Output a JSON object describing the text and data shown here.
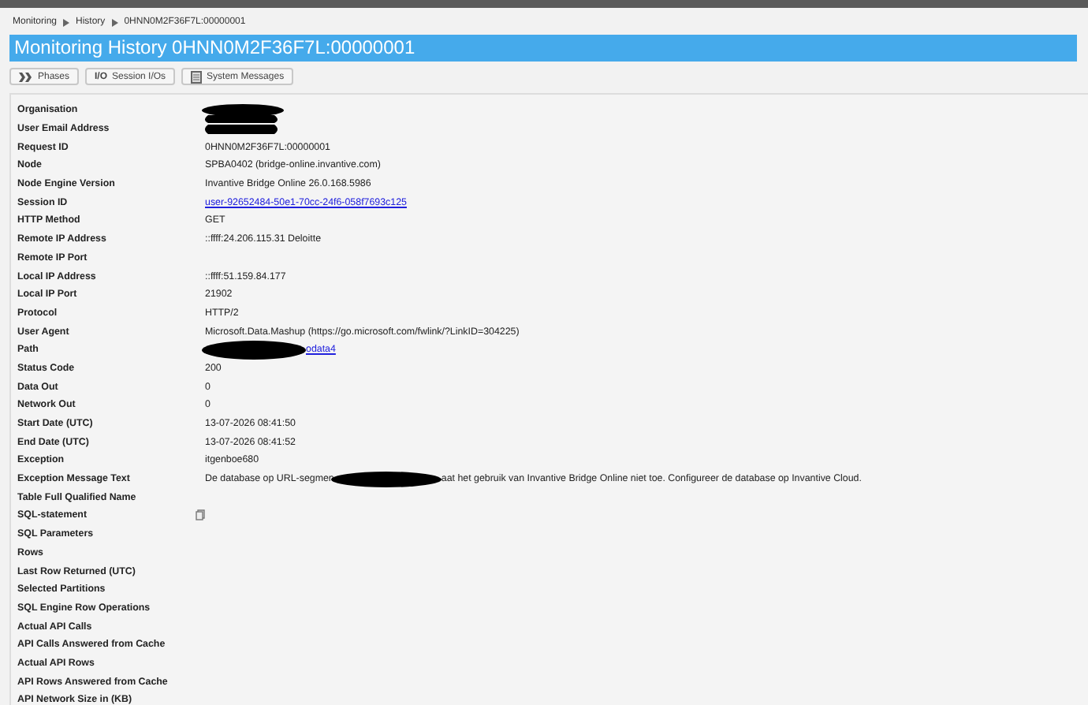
{
  "breadcrumb": [
    "Monitoring",
    "History",
    "0HNN0M2F36F7L:00000001"
  ],
  "title": "Monitoring History 0HNN0M2F36F7L:00000001",
  "buttons": [
    {
      "label": "Phases",
      "kind": "phases"
    },
    {
      "label": "Session I/Os",
      "kind": "io",
      "icon_text": "I/O"
    },
    {
      "label": "System Messages",
      "kind": "messages"
    }
  ],
  "rows": [
    {
      "label": "Organisation",
      "kind": "redacted"
    },
    {
      "label": "User Email Address",
      "kind": "redacted_double"
    },
    {
      "label": "Request ID",
      "kind": "text",
      "value": "0HNN0M2F36F7L:00000001"
    },
    {
      "label": "Node",
      "kind": "text",
      "value": "SPBA0402 (bridge-online.invantive.com)"
    },
    {
      "label": "Node Engine Version",
      "kind": "text",
      "value": "Invantive Bridge Online 26.0.168.5986"
    },
    {
      "label": "Session ID",
      "kind": "link",
      "value": "user-92652484-50e1-70cc-24f6-058f7693c125"
    },
    {
      "label": "HTTP Method",
      "kind": "text",
      "value": "GET"
    },
    {
      "label": "Remote IP Address",
      "kind": "text",
      "value": "::ffff:24.206.115.31 Deloitte"
    },
    {
      "label": "Remote IP Port",
      "kind": "empty"
    },
    {
      "label": "Local IP Address",
      "kind": "text",
      "value": "::ffff:51.159.84.177"
    },
    {
      "label": "Local IP Port",
      "kind": "text",
      "value": "21902"
    },
    {
      "label": "Protocol",
      "kind": "text",
      "value": "HTTP/2"
    },
    {
      "label": "User Agent",
      "kind": "text",
      "value": "Microsoft.Data.Mashup (https://go.microsoft.com/fwlink/?LinkID=304225)"
    },
    {
      "label": "Path",
      "kind": "redacted_link",
      "after": "odata4"
    },
    {
      "label": "Status Code",
      "kind": "text",
      "value": "200"
    },
    {
      "label": "Data Out",
      "kind": "text",
      "value": "0"
    },
    {
      "label": "Network Out",
      "kind": "text",
      "value": "0"
    },
    {
      "label": "Start Date (UTC)",
      "kind": "text",
      "value": "13-07-2026 08:41:50"
    },
    {
      "label": "End Date (UTC)",
      "kind": "text",
      "value": "13-07-2026 08:41:52"
    },
    {
      "label": "Exception",
      "kind": "text",
      "value": "itgenboe680"
    },
    {
      "label": "Exception Message Text",
      "kind": "redacted_text",
      "before": "De database op URL-segmen",
      "after": "aat het gebruik van Invantive Bridge Online niet toe. Configureer de database op Invantive Cloud."
    },
    {
      "label": "Table Full Qualified Name",
      "kind": "empty"
    },
    {
      "label": "SQL-statement",
      "kind": "copy"
    },
    {
      "label": "SQL Parameters",
      "kind": "empty"
    },
    {
      "label": "Rows",
      "kind": "empty"
    },
    {
      "label": "Last Row Returned (UTC)",
      "kind": "empty"
    },
    {
      "label": "Selected Partitions",
      "kind": "empty"
    },
    {
      "label": "SQL Engine Row Operations",
      "kind": "empty"
    },
    {
      "label": "Actual API Calls",
      "kind": "empty"
    },
    {
      "label": "API Calls Answered from Cache",
      "kind": "empty"
    },
    {
      "label": "Actual API Rows",
      "kind": "empty"
    },
    {
      "label": "API Rows Answered from Cache",
      "kind": "empty"
    },
    {
      "label": "API Network Size in (KB)",
      "kind": "empty"
    }
  ]
}
